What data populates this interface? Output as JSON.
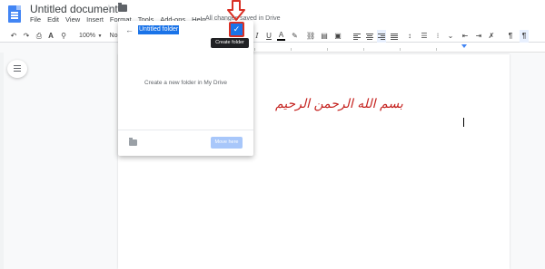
{
  "document": {
    "title": "Untitled document",
    "saved_status": "All changes saved in Drive"
  },
  "menu": [
    "File",
    "Edit",
    "View",
    "Insert",
    "Format",
    "Tools",
    "Add-ons",
    "Help"
  ],
  "toolbar": {
    "zoom": "100%",
    "style": "No",
    "bold": "B",
    "italic": "I",
    "underline": "U",
    "text_color": "A"
  },
  "dialog": {
    "folder_name": "Untitled folder",
    "empty_message": "Create a new folder in My Drive",
    "move_button_label": "Move here",
    "tooltip": "Create folder"
  },
  "content": {
    "arabic_text": "بسم الله الرحمن الرحيم"
  },
  "colors": {
    "accent": "#1a73e8",
    "docs_blue": "#4285f4",
    "annotation_red": "#d93025",
    "arabic_text": "#c5221f"
  },
  "icons": [
    "docs-logo-icon",
    "star-icon",
    "folder-icon",
    "undo-icon",
    "redo-icon",
    "print-icon",
    "spellcheck-icon",
    "paint-format-icon",
    "back-arrow-icon",
    "checkmark-icon",
    "new-folder-icon",
    "outline-icon",
    "link-icon",
    "comment-icon",
    "image-icon",
    "align-left-icon",
    "align-center-icon",
    "align-right-icon",
    "justify-icon",
    "line-spacing-icon",
    "numbered-list-icon",
    "bulleted-list-icon",
    "decrease-indent-icon",
    "increase-indent-icon",
    "clear-formatting-icon",
    "input-tools-icon",
    "down-arrow-annotation-icon"
  ]
}
